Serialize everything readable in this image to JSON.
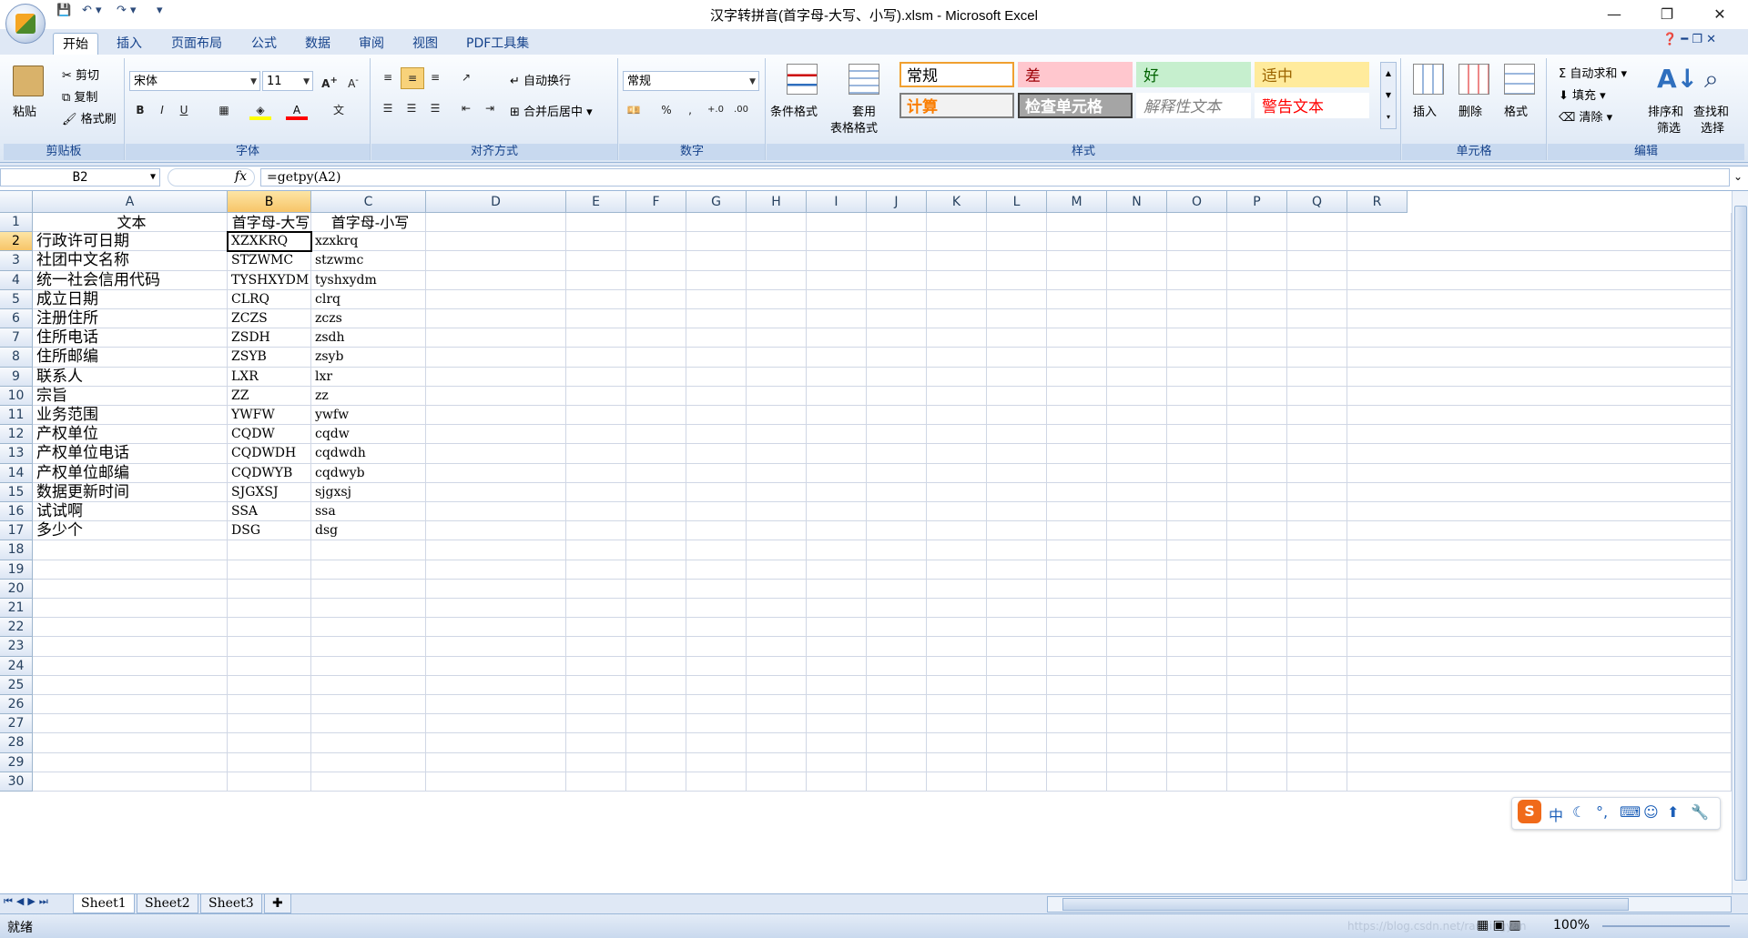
{
  "window": {
    "title": "汉字转拼音(首字母-大写、小写).xlsm - Microsoft Excel",
    "qat": [
      "💾",
      "↶ ▾",
      "↷ ▾",
      "▾"
    ],
    "controls": [
      "—",
      "❐",
      "✕"
    ]
  },
  "tabs": [
    "开始",
    "插入",
    "页面布局",
    "公式",
    "数据",
    "审阅",
    "视图",
    "PDF工具集"
  ],
  "ribbon": {
    "clipboard": {
      "label": "剪贴板",
      "paste": "粘贴",
      "cut": "剪切",
      "copy": "复制",
      "format_painter": "格式刷"
    },
    "font": {
      "label": "字体",
      "name": "宋体",
      "size": "11",
      "bold": "B",
      "italic": "I",
      "underline": "U"
    },
    "alignment": {
      "label": "对齐方式",
      "wrap": "自动换行",
      "merge": "合并后居中"
    },
    "number": {
      "label": "数字",
      "format": "常规",
      "percent": "%",
      "comma": ",",
      "inc": "+.0",
      "dec": ".00"
    },
    "styles": {
      "label": "样式",
      "conditional": "条件格式",
      "table_a": "套用",
      "table_b": "表格格式",
      "cells": [
        {
          "text": "常规",
          "bg": "#ffffff",
          "fg": "#000000",
          "border": "#f0a030"
        },
        {
          "text": "差",
          "bg": "#ffc7ce",
          "fg": "#9c0006",
          "border": "#ffc7ce"
        },
        {
          "text": "好",
          "bg": "#c6efce",
          "fg": "#006100",
          "border": "#c6efce"
        },
        {
          "text": "适中",
          "bg": "#ffeb9c",
          "fg": "#9c6500",
          "border": "#ffeb9c"
        },
        {
          "text": "计算",
          "bg": "#f2f2f2",
          "fg": "#fa7d00",
          "border": "#7f7f7f"
        },
        {
          "text": "检查单元格",
          "bg": "#a5a5a5",
          "fg": "#ffffff",
          "border": "#3f3f3f"
        },
        {
          "text": "解释性文本",
          "bg": "#ffffff",
          "fg": "#7f7f7f",
          "border": "#ffffff"
        },
        {
          "text": "警告文本",
          "bg": "#ffffff",
          "fg": "#ff0000",
          "border": "#ffffff"
        }
      ]
    },
    "cells": {
      "label": "单元格",
      "insert": "插入",
      "delete": "删除",
      "format": "格式"
    },
    "editing": {
      "label": "编辑",
      "autosum": "自动求和",
      "fill": "填充",
      "clear": "清除",
      "sort_a": "排序和",
      "sort_b": "筛选",
      "find_a": "查找和",
      "find_b": "选择"
    }
  },
  "formula_bar": {
    "name_box": "B2",
    "fx": "fx",
    "formula": "=getpy(A2)"
  },
  "grid": {
    "columns": [
      "A",
      "B",
      "C",
      "D",
      "E",
      "F",
      "G",
      "H",
      "I",
      "J",
      "K",
      "L",
      "M",
      "N",
      "O",
      "P",
      "Q",
      "R"
    ],
    "row_numbers": [
      "1",
      "2",
      "3",
      "4",
      "5",
      "6",
      "7",
      "8",
      "9",
      "10",
      "11",
      "12",
      "13",
      "14",
      "15",
      "16",
      "17",
      "18",
      "19",
      "20",
      "21",
      "22",
      "23",
      "24",
      "25",
      "26",
      "27",
      "28",
      "29",
      "30"
    ],
    "headers": [
      "文本",
      "首字母-大写",
      "首字母-小写"
    ],
    "rows": [
      [
        "行政许可日期",
        "XZXKRQ",
        "xzxkrq"
      ],
      [
        "社团中文名称",
        "STZWMC",
        "stzwmc"
      ],
      [
        "统一社会信用代码",
        "TYSHXYDM",
        "tyshxydm"
      ],
      [
        "成立日期",
        "CLRQ",
        "clrq"
      ],
      [
        "注册住所",
        "ZCZS",
        "zczs"
      ],
      [
        "住所电话",
        "ZSDH",
        "zsdh"
      ],
      [
        "住所邮编",
        "ZSYB",
        "zsyb"
      ],
      [
        "联系人",
        "LXR",
        "lxr"
      ],
      [
        "宗旨",
        "ZZ",
        "zz"
      ],
      [
        "业务范围",
        "YWFW",
        "ywfw"
      ],
      [
        "产权单位",
        "CQDW",
        "cqdw"
      ],
      [
        "产权单位电话",
        "CQDWDH",
        "cqdwdh"
      ],
      [
        "产权单位邮编",
        "CQDWYB",
        "cqdwyb"
      ],
      [
        "数据更新时间",
        "SJGXSJ",
        "sjgxsj"
      ],
      [
        "试试啊",
        "SSA",
        "ssa"
      ],
      [
        "多少个",
        "DSG",
        "dsg"
      ]
    ]
  },
  "sheet_tabs": [
    "Sheet1",
    "Sheet2",
    "Sheet3"
  ],
  "status": {
    "ready": "就绪",
    "zoom": "100%",
    "watermark": "https://blog.csdn.net/ranqingyan"
  },
  "ime": {
    "label": "中",
    "logo": "S"
  }
}
